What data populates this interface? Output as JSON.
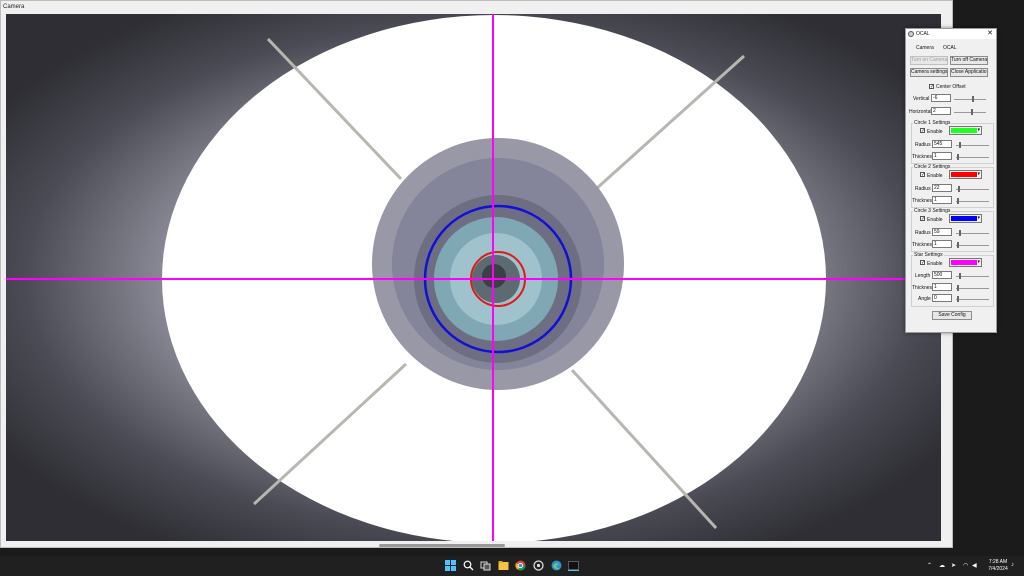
{
  "camera_window": {
    "title": "Camera"
  },
  "ocal": {
    "title": "OCAL",
    "close_glyph": "✕",
    "tabs": [
      "Camera",
      "OCAL"
    ],
    "buttons": {
      "turn_on": "Turn on Camera",
      "turn_off": "Turn off Camera",
      "camera_settings": "Camera settings",
      "close_app": "Close Application",
      "save": "Save Config"
    },
    "center_offset": {
      "label": "Center Offset",
      "checked": true
    },
    "vertical": {
      "label": "Vertical",
      "value": "-6",
      "level": 0.6
    },
    "horizontal": {
      "label": "Horizontal",
      "value": "2",
      "level": 0.55
    },
    "circles": [
      {
        "title": "Circle 1 Settings",
        "enable": "Enable",
        "color": "#22ff22",
        "radius_label": "Radius",
        "radius": "545",
        "thickness_label": "Thickness",
        "thickness": "1"
      },
      {
        "title": "Circle 2 Settings",
        "enable": "Enable",
        "color": "#ff0000",
        "radius_label": "Radius",
        "radius": "22",
        "thickness_label": "Thickness",
        "thickness": "1"
      },
      {
        "title": "Circle 3 Settings",
        "enable": "Enable",
        "color": "#0000ff",
        "radius_label": "Radius",
        "radius": "59",
        "thickness_label": "Thickness",
        "thickness": "1"
      }
    ],
    "star": {
      "title": "Star Settings",
      "enable": "Enable",
      "color": "#ff00ff",
      "length_label": "Length",
      "length": "500",
      "thickness_label": "Thickness",
      "thickness": "1",
      "angle_label": "Angle",
      "angle": "0"
    }
  },
  "overlay_colors": {
    "crosshair": "#ff00ff",
    "circle_red": "#e01818",
    "circle_blue": "#1010d8"
  },
  "taskbar": {
    "icons": [
      "windows-start-icon",
      "search-icon",
      "task-view-icon",
      "file-explorer-icon",
      "chrome-icon",
      "app-icon",
      "edge-icon",
      "terminal-icon"
    ],
    "time": "7:28 AM",
    "date": "7/4/2024"
  }
}
